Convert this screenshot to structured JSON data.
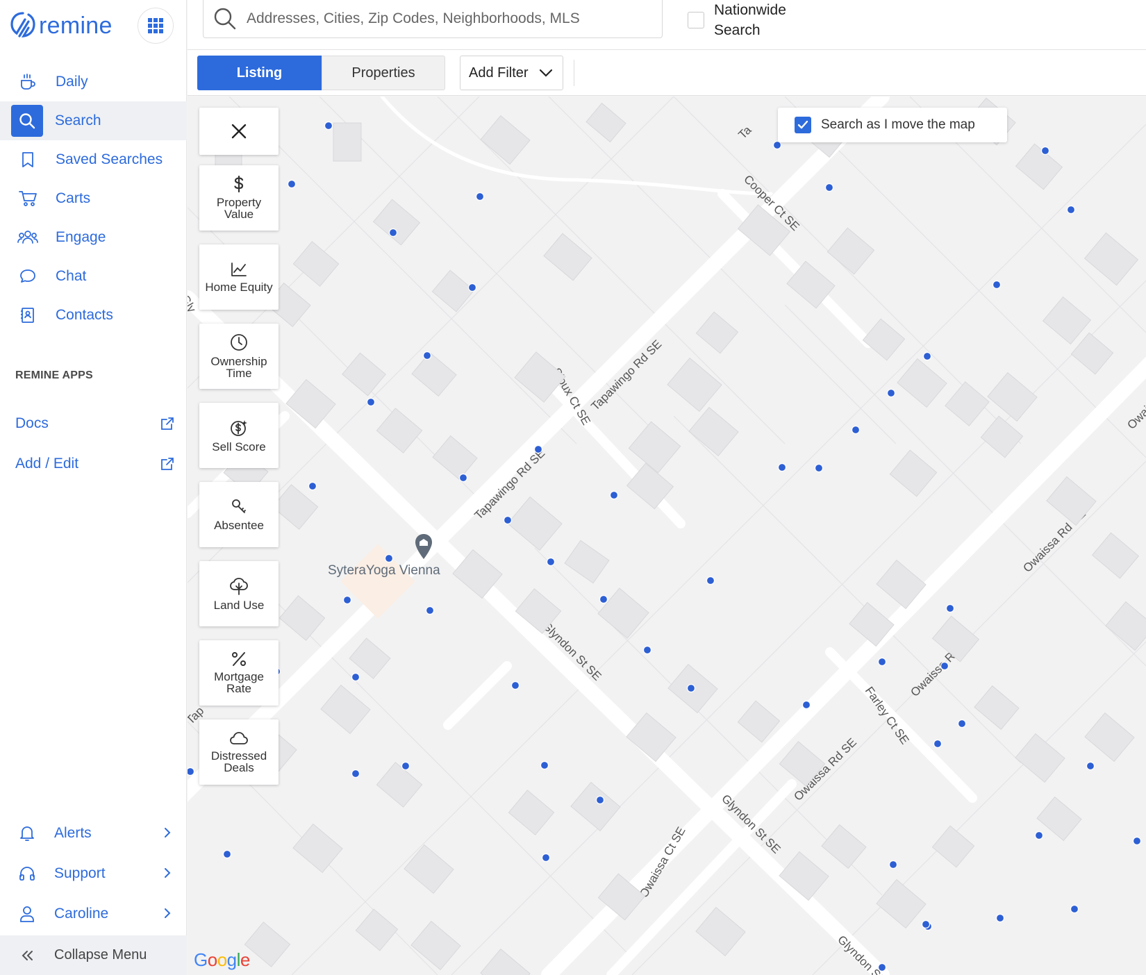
{
  "brand": {
    "name": "remine",
    "color": "#2d6bdc"
  },
  "sidebar": {
    "items": [
      {
        "label": "Daily",
        "icon": "coffee-cup-icon"
      },
      {
        "label": "Search",
        "icon": "search-icon",
        "active": true
      },
      {
        "label": "Saved Searches",
        "icon": "bookmark-icon"
      },
      {
        "label": "Carts",
        "icon": "cart-icon"
      },
      {
        "label": "Engage",
        "icon": "people-icon"
      },
      {
        "label": "Chat",
        "icon": "chat-bubble-icon"
      },
      {
        "label": "Contacts",
        "icon": "contacts-book-icon"
      }
    ],
    "apps_heading": "REMINE APPS",
    "apps": [
      {
        "label": "Docs",
        "icon": "external-link-icon"
      },
      {
        "label": "Add / Edit",
        "icon": "external-link-icon"
      }
    ],
    "bottom": [
      {
        "label": "Alerts",
        "icon": "bell-icon"
      },
      {
        "label": "Support",
        "icon": "headset-icon"
      },
      {
        "label": "Caroline",
        "icon": "user-icon"
      }
    ],
    "collapse_label": "Collapse Menu"
  },
  "search": {
    "placeholder": "Addresses, Cities, Zip Codes, Neighborhoods, MLS",
    "nationwide_label": "Nationwide Search",
    "nationwide_checked": false
  },
  "filters": {
    "tabs": [
      "Listing",
      "Properties"
    ],
    "active_tab": "Listing",
    "add_filter_label": "Add Filter"
  },
  "map": {
    "search_as_move_label": "Search as I move the map",
    "search_as_move_checked": true,
    "poi_label": "SyteraYoga Vienna",
    "attribution": "Google",
    "street_labels": [
      "Tapawingo Rd SE",
      "Tapawingo Rd SE",
      "Cooper Ct SE",
      "Sioux Ct SE",
      "Glyndon St SE",
      "Glyndon St SE",
      "Glyndon St SE",
      "Owaissa Rd SE",
      "Owaissa Rd SE",
      "Owaissa Rd SE",
      "Owaissa Rd SE",
      "Owaissa Ct SE",
      "Farley Ct SE",
      "Gly",
      "Tap",
      "Ta"
    ],
    "pin_color": "#2d5fd4",
    "tools": [
      {
        "label": "Property Value",
        "icon": "dollar-icon"
      },
      {
        "label": "Home Equity",
        "icon": "line-chart-icon"
      },
      {
        "label": "Ownership Time",
        "icon": "clock-icon"
      },
      {
        "label": "Sell Score",
        "icon": "sell-score-icon"
      },
      {
        "label": "Absentee",
        "icon": "key-icon"
      },
      {
        "label": "Land Use",
        "icon": "tree-icon"
      },
      {
        "label": "Mortgage Rate",
        "icon": "percent-icon"
      },
      {
        "label": "Distressed Deals",
        "icon": "cloud-icon"
      }
    ]
  }
}
